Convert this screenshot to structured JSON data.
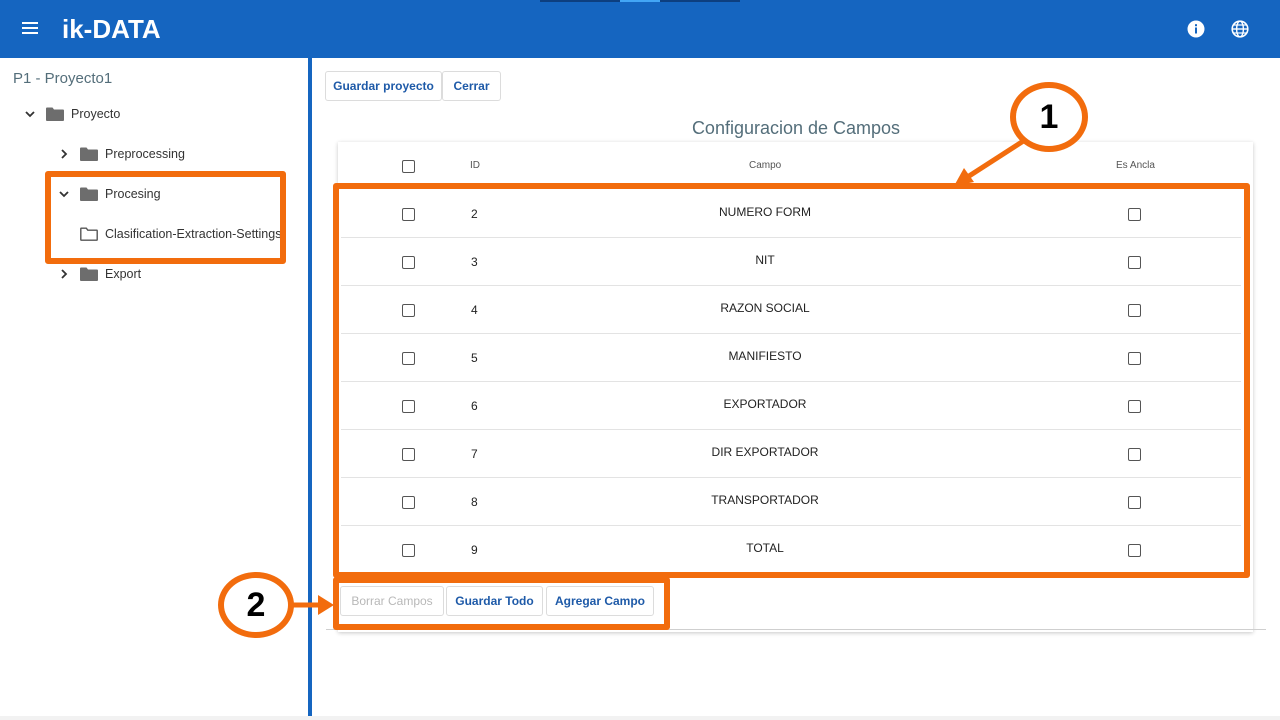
{
  "app": {
    "logo_text": "ik-DATA"
  },
  "sidebar": {
    "project_title": "P1 - Proyecto1",
    "tree": {
      "root": "Proyecto",
      "preprocessing": "Preprocessing",
      "procesing": "Procesing",
      "clasification": "Clasification-Extraction-Settings",
      "export": "Export"
    }
  },
  "toolbar": {
    "save_project": "Guardar proyecto",
    "close": "Cerrar"
  },
  "section": {
    "title": "Configuracion de Campos"
  },
  "table": {
    "headers": {
      "id": "ID",
      "campo": "Campo",
      "es_ancla": "Es Ancla"
    },
    "rows": [
      {
        "id": "2",
        "campo": "NUMERO FORM"
      },
      {
        "id": "3",
        "campo": "NIT"
      },
      {
        "id": "4",
        "campo": "RAZON SOCIAL"
      },
      {
        "id": "5",
        "campo": "MANIFIESTO"
      },
      {
        "id": "6",
        "campo": "EXPORTADOR"
      },
      {
        "id": "7",
        "campo": "DIR EXPORTADOR"
      },
      {
        "id": "8",
        "campo": "TRANSPORTADOR"
      },
      {
        "id": "9",
        "campo": "TOTAL"
      }
    ]
  },
  "actions": {
    "delete": "Borrar Campos",
    "save_all": "Guardar Todo",
    "add": "Agregar Campo"
  },
  "annotations": {
    "one": "1",
    "two": "2"
  },
  "colors": {
    "brand": "#1565c0",
    "highlight": "#f26c0d",
    "title": "#546e7a",
    "button_text": "#1e5aa8"
  }
}
